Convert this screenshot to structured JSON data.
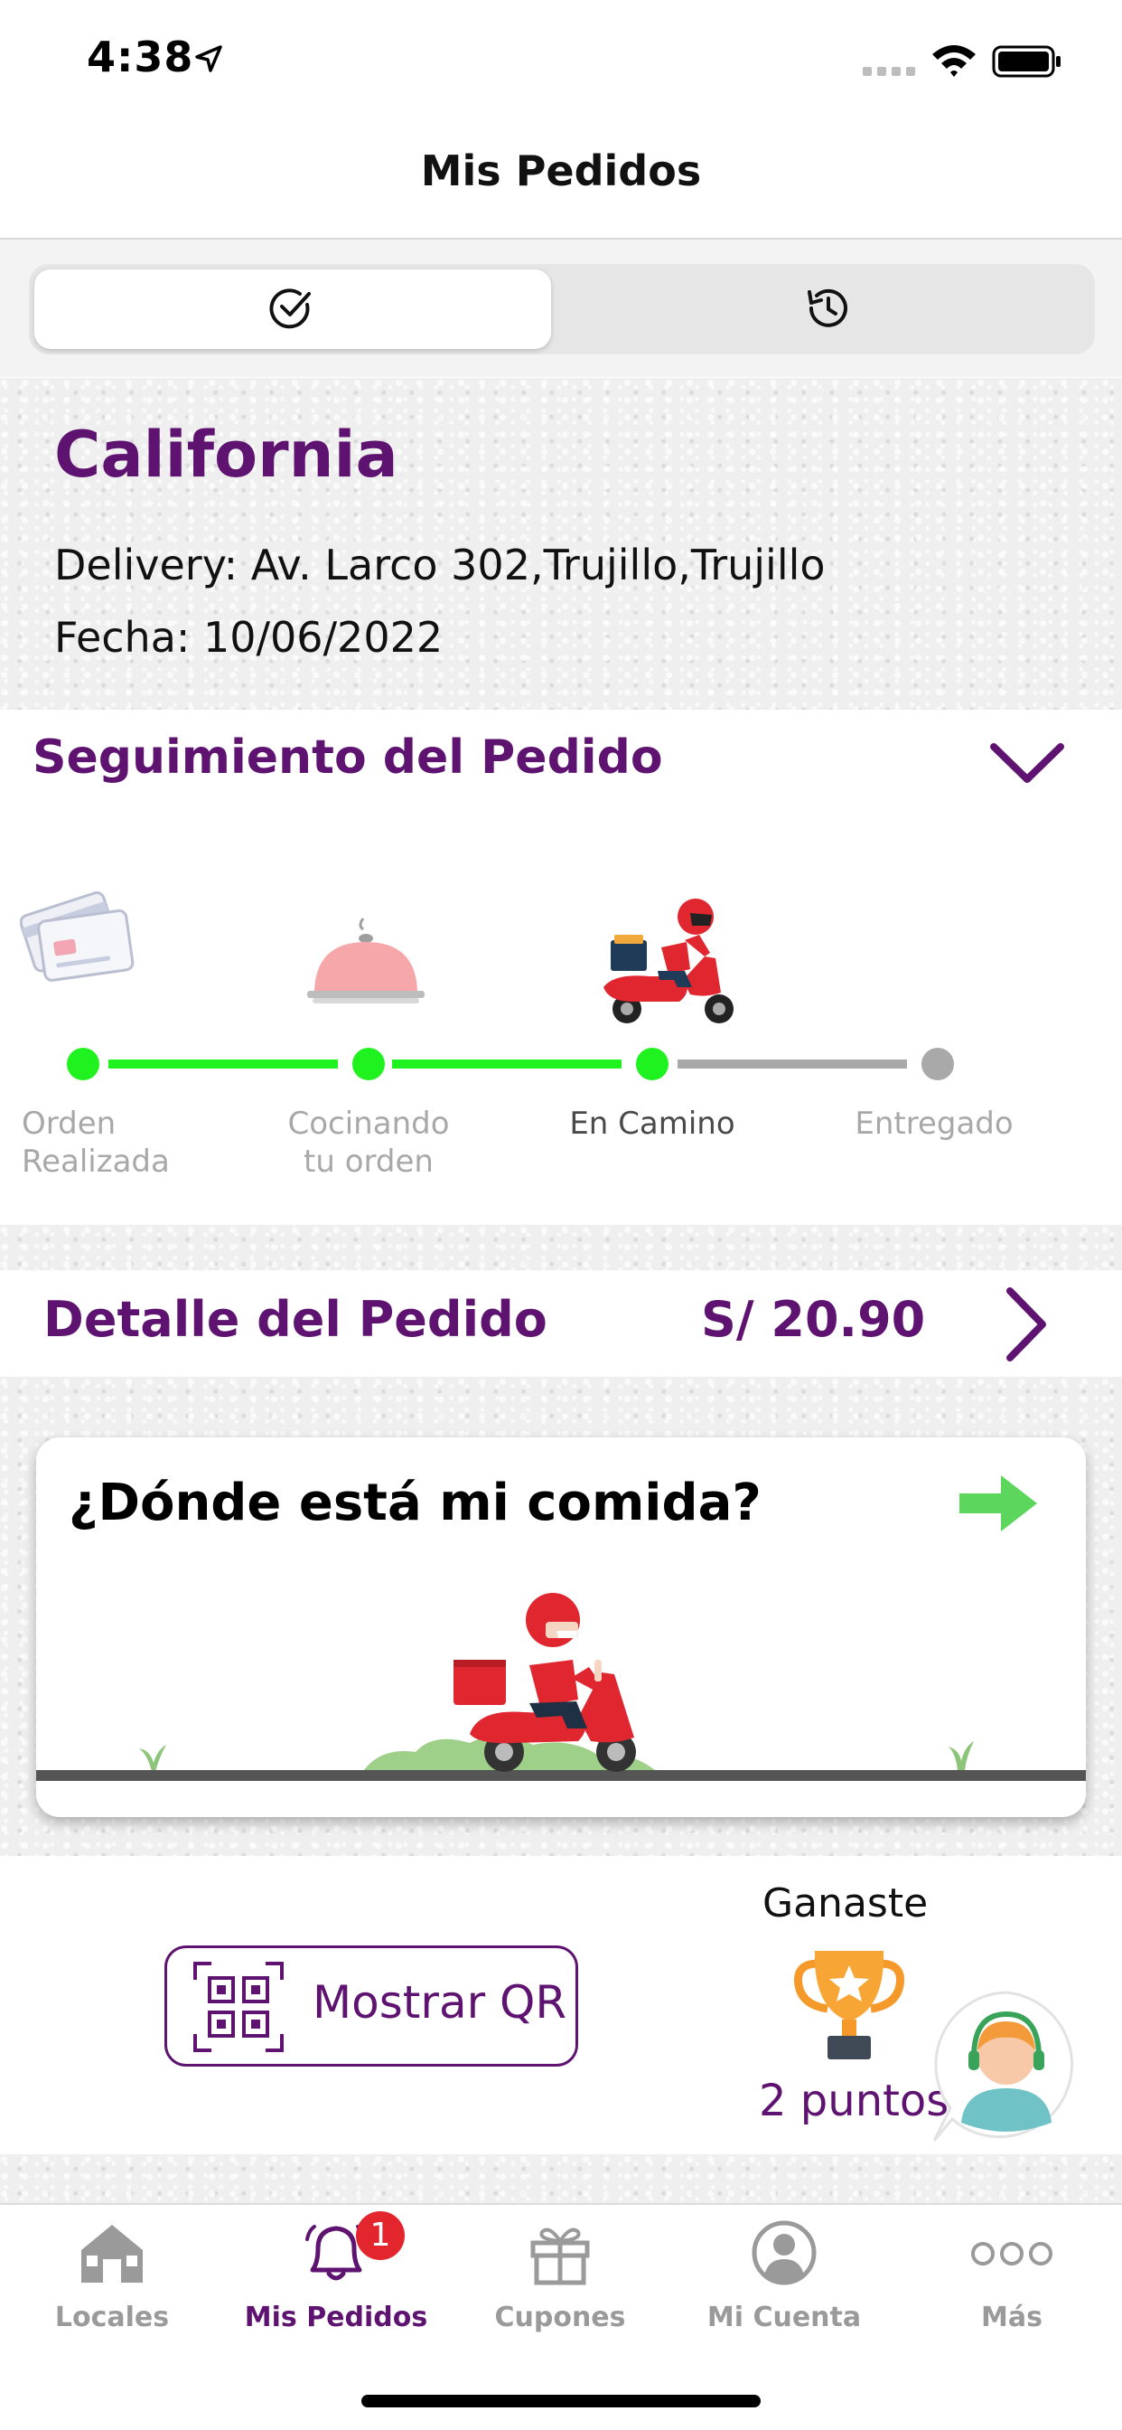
{
  "status_bar": {
    "time": "4:38"
  },
  "header": {
    "title": "Mis Pedidos"
  },
  "segments": [
    {
      "icon": "check-circle-icon",
      "active": true
    },
    {
      "icon": "history-icon",
      "active": false
    }
  ],
  "order": {
    "store_name": "California",
    "delivery": "Delivery: Av. Larco 302,Trujillo,Trujillo",
    "date": "Fecha: 10/06/2022"
  },
  "tracking": {
    "title": "Seguimiento del Pedido",
    "steps": [
      {
        "label_line1": "Orden",
        "label_line2": "Realizada",
        "done": true,
        "icon": "credit-card-icon"
      },
      {
        "label_line1": "Cocinando",
        "label_line2": "tu orden",
        "done": true,
        "icon": "food-cloche-icon"
      },
      {
        "label_line1": "En Camino",
        "label_line2": "",
        "done": true,
        "current": true,
        "icon": "delivery-scooter-icon"
      },
      {
        "label_line1": "Entregado",
        "label_line2": "",
        "done": false
      }
    ],
    "colors": {
      "done": "#1ff21f",
      "pending": "#a9a9a9",
      "current_label": "#4a4a4a"
    }
  },
  "detail": {
    "title": "Detalle del Pedido",
    "price": "S/ 20.90"
  },
  "food_card": {
    "title": "¿Dónde está mi comida?"
  },
  "qr": {
    "label": "Mostrar QR"
  },
  "rewards": {
    "title": "Ganaste",
    "points": "2 puntos"
  },
  "tabs": [
    {
      "label": "Locales",
      "icon": "store-icon",
      "active": false
    },
    {
      "label": "Mis Pedidos",
      "icon": "bell-icon",
      "active": true,
      "badge": "1"
    },
    {
      "label": "Cupones",
      "icon": "gift-icon",
      "active": false
    },
    {
      "label": "Mi Cuenta",
      "icon": "user-icon",
      "active": false
    },
    {
      "label": "Más",
      "icon": "more-icon",
      "active": false
    }
  ],
  "colors": {
    "brand": "#5e1370",
    "badge": "#e3262e",
    "arrow_green": "#5cd65c"
  }
}
